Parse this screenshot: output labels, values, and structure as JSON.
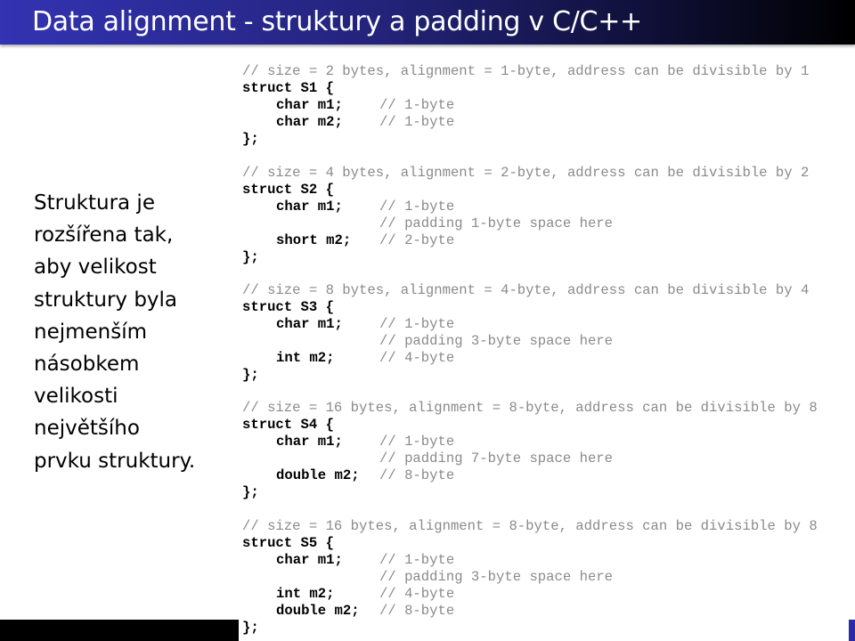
{
  "slide": {
    "title": "Data alignment - struktury a padding v C/C++",
    "body_lines": [
      "Struktura je",
      "rozšířena tak,",
      "aby velikost",
      "struktury byla",
      "nejmenším",
      "násobkem",
      "velikosti",
      "největšího",
      "prvku struktury."
    ]
  },
  "code_blocks": [
    {
      "comment": "// size = 2 bytes, alignment = 1-byte, address can be divisible by 1",
      "header": "struct S1 {",
      "members": [
        {
          "decl": "char m1;",
          "comment": "// 1-byte"
        },
        {
          "decl": "char m2;",
          "comment": "// 1-byte"
        }
      ],
      "footer": "};"
    },
    {
      "comment": "// size = 4 bytes, alignment = 2-byte, address can be divisible by 2",
      "header": "struct S2 {",
      "members": [
        {
          "decl": "char m1;",
          "comment": "// 1-byte"
        },
        {
          "decl": "",
          "comment": "// padding 1-byte space here"
        },
        {
          "decl": "short m2;",
          "comment": "// 2-byte"
        }
      ],
      "footer": "};"
    },
    {
      "comment": "// size = 8 bytes, alignment = 4-byte, address can be divisible by 4",
      "header": "struct S3 {",
      "members": [
        {
          "decl": "char m1;",
          "comment": "// 1-byte"
        },
        {
          "decl": "",
          "comment": "// padding 3-byte space here"
        },
        {
          "decl": "int m2;",
          "comment": "// 4-byte"
        }
      ],
      "footer": "};"
    },
    {
      "comment": "// size = 16 bytes, alignment = 8-byte, address can be divisible by 8",
      "header": "struct S4 {",
      "members": [
        {
          "decl": "char m1;",
          "comment": "// 1-byte"
        },
        {
          "decl": "",
          "comment": "// padding 7-byte space here"
        },
        {
          "decl": "double m2;",
          "comment": "// 8-byte"
        }
      ],
      "footer": "};"
    },
    {
      "comment": "// size = 16 bytes, alignment = 8-byte, address can be divisible by 8",
      "header": "struct S5 {",
      "members": [
        {
          "decl": "char m1;",
          "comment": "// 1-byte"
        },
        {
          "decl": "",
          "comment": "// padding 3-byte space here"
        },
        {
          "decl": "int m2;",
          "comment": "// 4-byte"
        },
        {
          "decl": "double m2;",
          "comment": "// 8-byte"
        }
      ],
      "footer": "};"
    }
  ],
  "colors": {
    "header_gradient_start": "#3333b3",
    "header_gradient_end": "#000000",
    "code_comment": "#8a8a8a",
    "code_keyword": "#000000"
  }
}
